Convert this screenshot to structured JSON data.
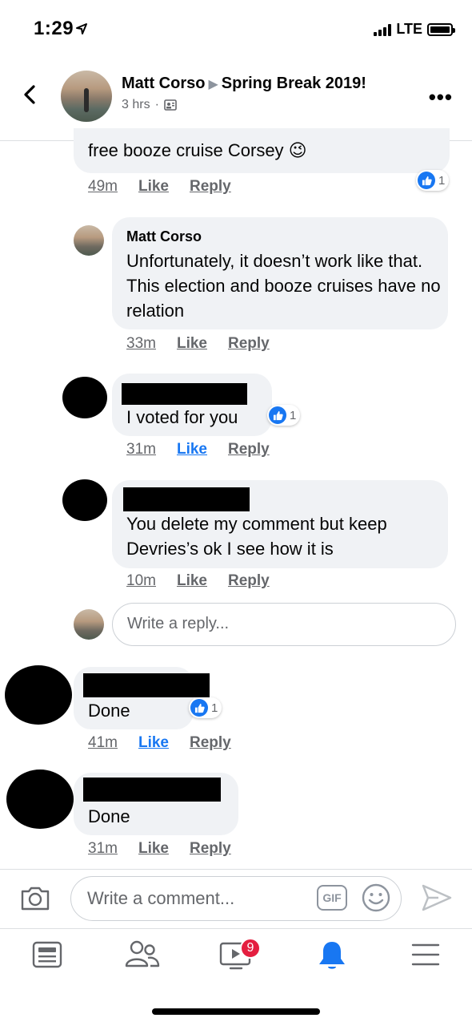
{
  "status": {
    "time": "1:29",
    "network": "LTE"
  },
  "header": {
    "author": "Matt Corso",
    "group": "Spring Break 2019!",
    "time": "3 hrs"
  },
  "comments": [
    {
      "text": "free booze cruise Corsey 😉",
      "time": "49m",
      "like": "Like",
      "reply": "Reply",
      "reactions": "1"
    },
    {
      "name": "Matt Corso",
      "text": "Unfortunately, it doesn’t work like that. This election and booze cruises have no relation",
      "time": "33m",
      "like": "Like",
      "reply": "Reply"
    },
    {
      "text": "I voted for you",
      "time": "31m",
      "like": "Like",
      "reply": "Reply",
      "reactions": "1"
    },
    {
      "text": "You delete my comment but keep Devries’s ok I see how it is",
      "time": "10m",
      "like": "Like",
      "reply": "Reply"
    },
    {
      "text": "Done",
      "time": "41m",
      "like": "Like",
      "reply": "Reply",
      "reactions": "1"
    },
    {
      "text": "Done",
      "time": "31m",
      "like": "Like",
      "reply": "Reply"
    }
  ],
  "reply_input": {
    "placeholder": "Write a reply..."
  },
  "comment_input": {
    "placeholder": "Write a comment...",
    "gif_label": "GIF"
  },
  "tabs": {
    "watch_badge": "9"
  },
  "colors": {
    "accent": "#1877f2",
    "bubble": "#f0f2f5",
    "badge": "#e41e3f"
  }
}
